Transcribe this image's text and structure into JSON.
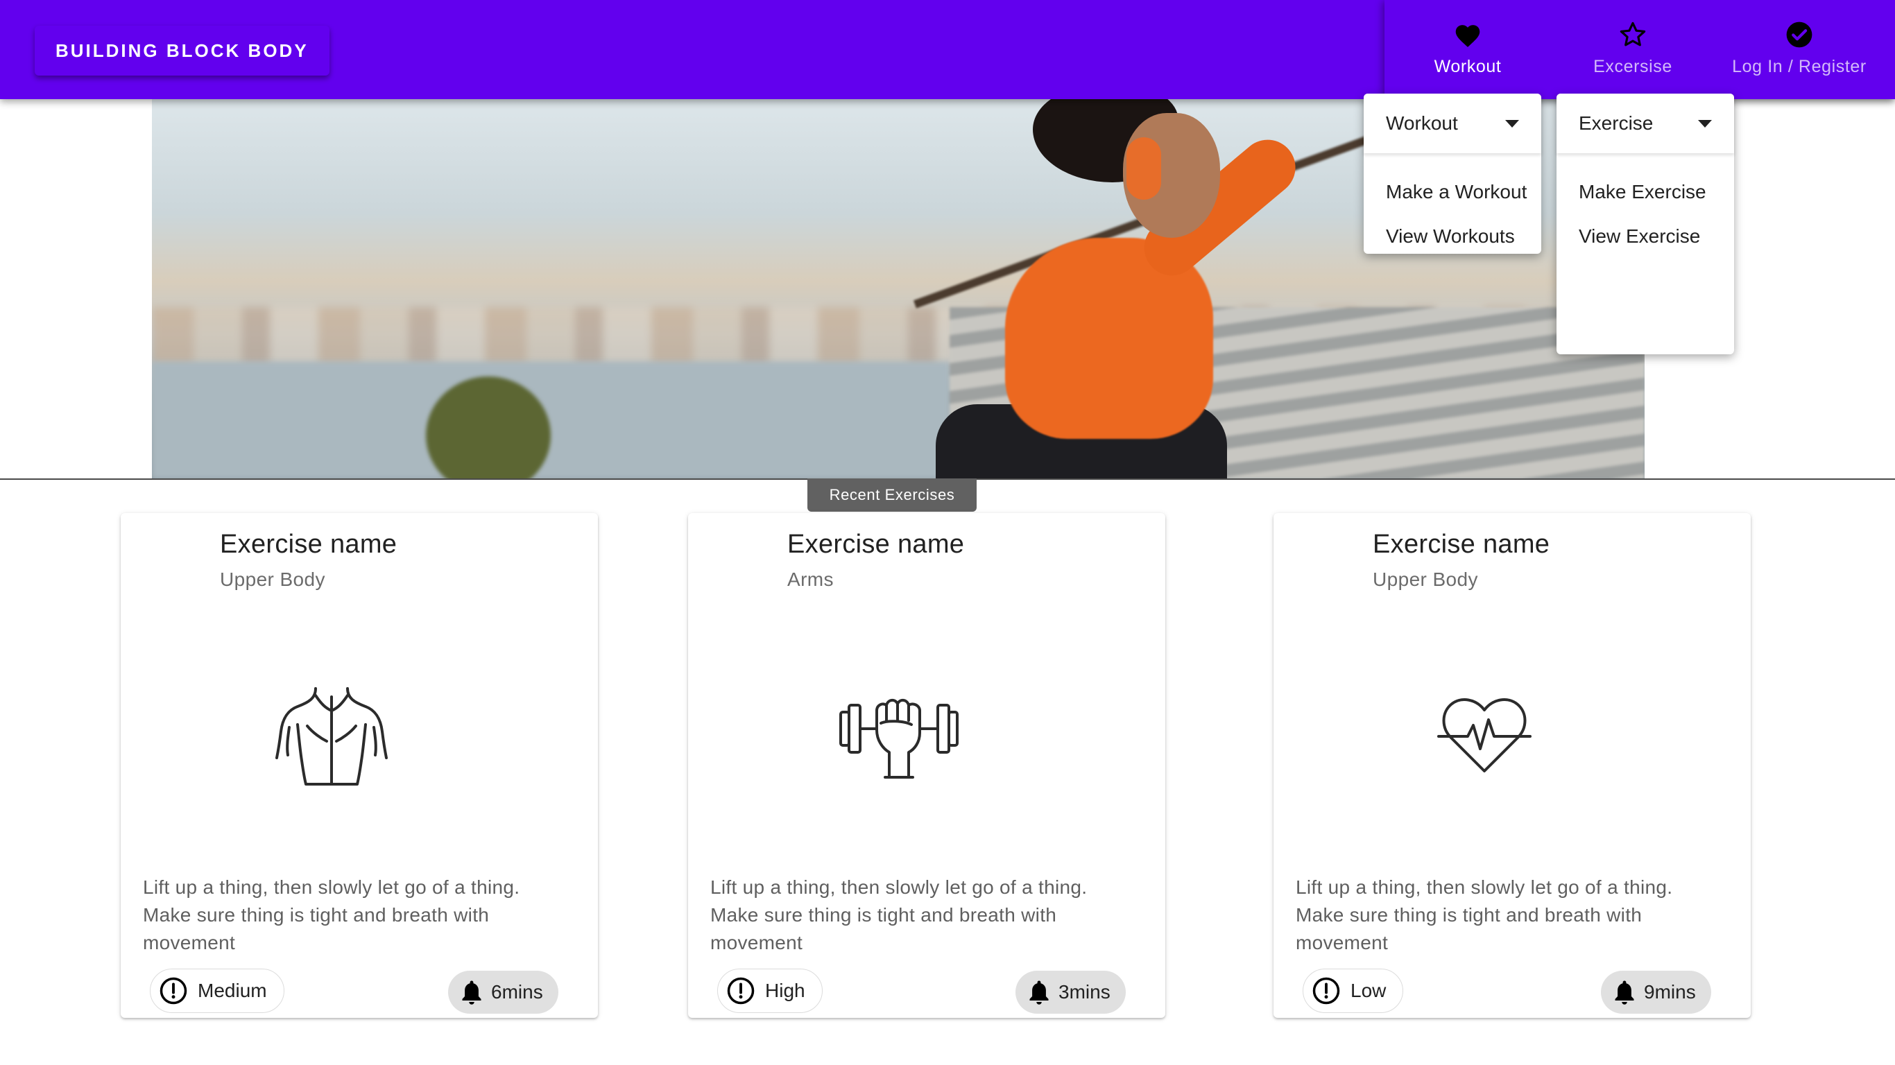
{
  "appbar": {
    "brand": "BUILDING BLOCK BODY",
    "nav": [
      {
        "label": "Workout",
        "icon": "heart-icon",
        "active": true
      },
      {
        "label": "Excersise",
        "icon": "star-outline-icon",
        "active": false
      },
      {
        "label": "Log In / Register",
        "icon": "check-circle-icon",
        "active": false
      }
    ],
    "color": "#6200ee"
  },
  "menus": {
    "workout": {
      "selected": "Workout",
      "items": [
        "Make a Workout",
        "View Workouts"
      ]
    },
    "exercise": {
      "selected": "Exercise",
      "items": [
        "Make Exercise",
        "View Exercise"
      ]
    }
  },
  "hero": {
    "image": "woman-in-orange-exercising-on-stairs",
    "tooltip": "Recent Exercises"
  },
  "cards": [
    {
      "title": "Exercise name",
      "subtitle": "Upper Body",
      "icon": "torso-back-icon",
      "description": "Lift up a thing, then slowly let go of a thing. Make sure thing is tight and breath with movement",
      "level": "Medium",
      "time": "6mins"
    },
    {
      "title": "Exercise name",
      "subtitle": "Arms",
      "icon": "fist-dumbbell-icon",
      "description": "Lift up a thing, then slowly let go of a thing. Make sure thing is tight and breath with movement",
      "level": "High",
      "time": "3mins"
    },
    {
      "title": "Exercise name",
      "subtitle": "Upper Body",
      "icon": "heart-pulse-icon",
      "description": "Lift up a thing, then slowly let go of a thing. Make sure thing is tight and breath with movement",
      "level": "Low",
      "time": "9mins"
    }
  ]
}
